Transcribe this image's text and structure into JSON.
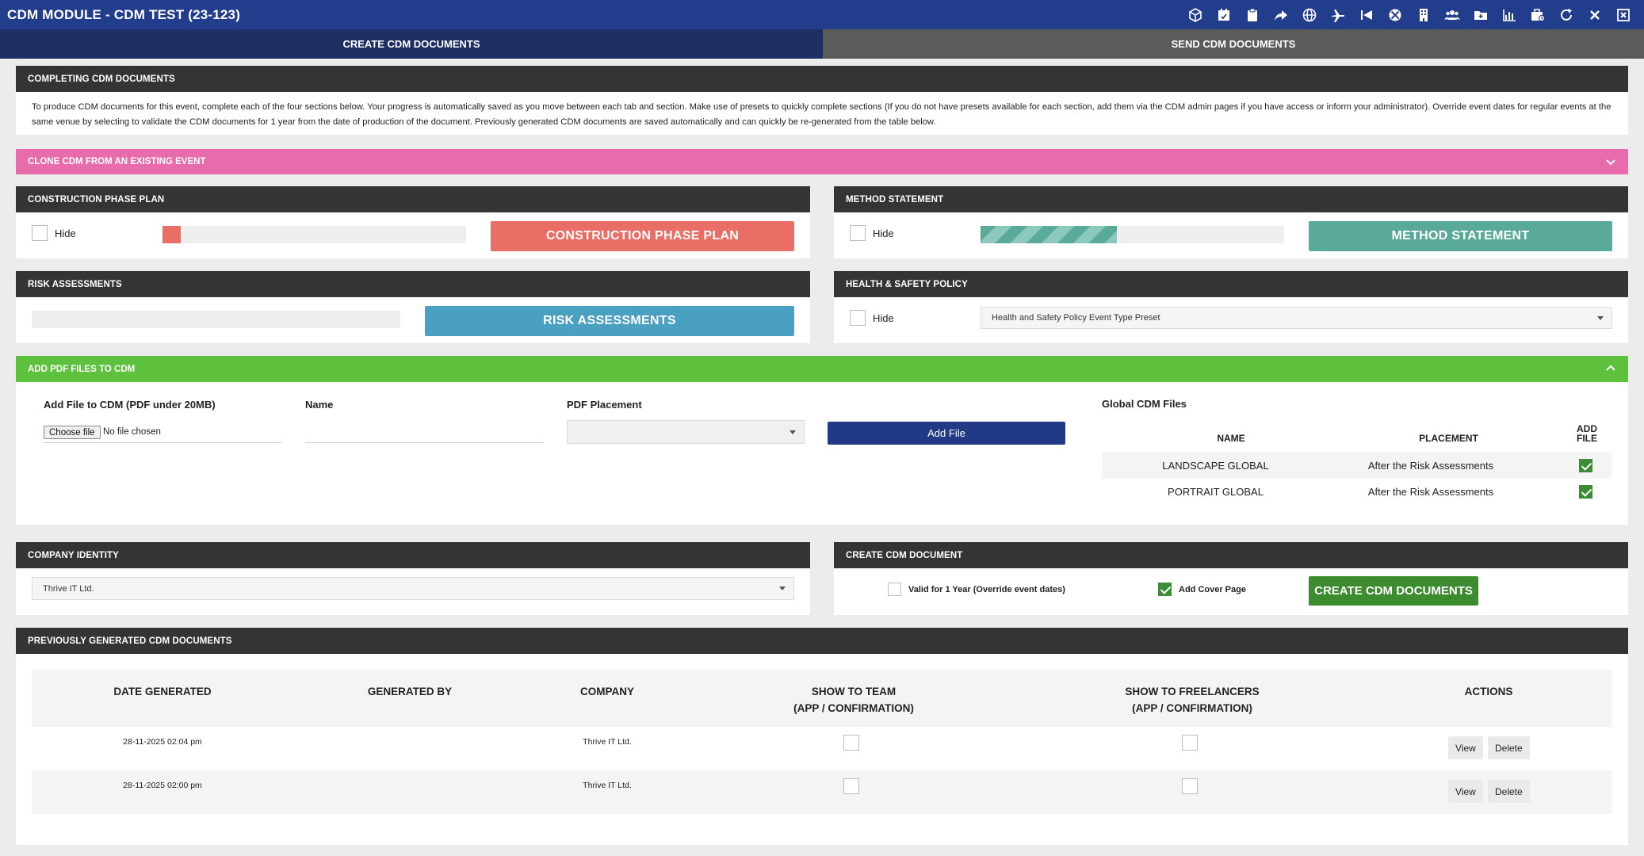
{
  "app": {
    "title": "CDM MODULE - CDM TEST (23-123)"
  },
  "toolbar_icons": [
    "box-icon",
    "calendar-icon",
    "clipboard-icon",
    "share-icon",
    "globe-icon",
    "plane-icon",
    "skip-back-icon",
    "xbox-icon",
    "building-icon",
    "team-icon",
    "folder-icon",
    "chart-icon",
    "toolbox-icon",
    "refresh-icon",
    "close-icon",
    "close-window-icon"
  ],
  "tabs": {
    "create": "CREATE CDM DOCUMENTS",
    "send": "SEND CDM DOCUMENTS"
  },
  "intro": {
    "heading": "COMPLETING CDM DOCUMENTS",
    "text": "To produce CDM documents for this event, complete each of the four sections below. Your progress is automatically saved as you move between each tab and section. Make use of presets to quickly complete sections (If you do not have presets available for each section, add them via the CDM admin pages if you have access or inform your administrator). Override event dates for regular events at the same venue by selecting to validate the CDM documents for 1 year from the date of production of the document. Previously generated CDM documents are saved automatically and can quickly be re-generated from the table below."
  },
  "clone": {
    "heading": "CLONE CDM FROM AN EXISTING EVENT"
  },
  "construction": {
    "heading": "CONSTRUCTION PHASE PLAN",
    "hide_label": "Hide",
    "button": "CONSTRUCTION PHASE PLAN",
    "color": "#e86e66",
    "progress": 0.06
  },
  "method": {
    "heading": "METHOD STATEMENT",
    "hide_label": "Hide",
    "button": "METHOD STATEMENT",
    "color": "#5aaa99",
    "progress": 0.45
  },
  "risk": {
    "heading": "RISK ASSESSMENTS",
    "button": "RISK ASSESSMENTS",
    "color": "#4aa0c0",
    "progress": 0
  },
  "health": {
    "heading": "HEALTH & SAFETY POLICY",
    "hide_label": "Hide",
    "select_value": "Health and Safety Policy Event Type Preset"
  },
  "pdf": {
    "heading": "ADD PDF FILES TO CDM",
    "file_label": "Add File to CDM (PDF under 20MB)",
    "choose_file": "Choose file",
    "no_file": "No file chosen",
    "name_label": "Name",
    "placement_label": "PDF Placement",
    "add_button": "Add File",
    "global": {
      "title": "Global CDM Files",
      "col_name": "NAME",
      "col_placement": "PLACEMENT",
      "col_add_1": "ADD",
      "col_add_2": "FILE",
      "rows": [
        {
          "name": "LANDSCAPE GLOBAL",
          "placement": "After the Risk Assessments",
          "checked": true
        },
        {
          "name": "PORTRAIT GLOBAL",
          "placement": "After the Risk Assessments",
          "checked": true
        }
      ]
    }
  },
  "company": {
    "heading": "COMPANY IDENTITY",
    "select_value": "Thrive IT Ltd."
  },
  "create": {
    "heading": "CREATE CDM DOCUMENT",
    "valid_label": "Valid for 1 Year (Override event dates)",
    "cover_label": "Add Cover Page",
    "button": "CREATE CDM DOCUMENTS"
  },
  "previous": {
    "heading": "PREVIOUSLY GENERATED CDM DOCUMENTS",
    "columns": {
      "date": "DATE GENERATED",
      "by": "GENERATED BY",
      "company": "COMPANY",
      "team_1": "SHOW TO TEAM",
      "team_2": "(APP / CONFIRMATION)",
      "free_1": "SHOW TO FREELANCERS",
      "free_2": "(APP / CONFIRMATION)",
      "actions": "ACTIONS"
    },
    "rows": [
      {
        "date": "28-11-2025 02:04 pm",
        "by": "",
        "company": "Thrive IT Ltd.",
        "view": "View",
        "delete": "Delete"
      },
      {
        "date": "28-11-2025 02:00 pm",
        "by": "",
        "company": "Thrive IT Ltd.",
        "view": "View",
        "delete": "Delete"
      }
    ]
  }
}
